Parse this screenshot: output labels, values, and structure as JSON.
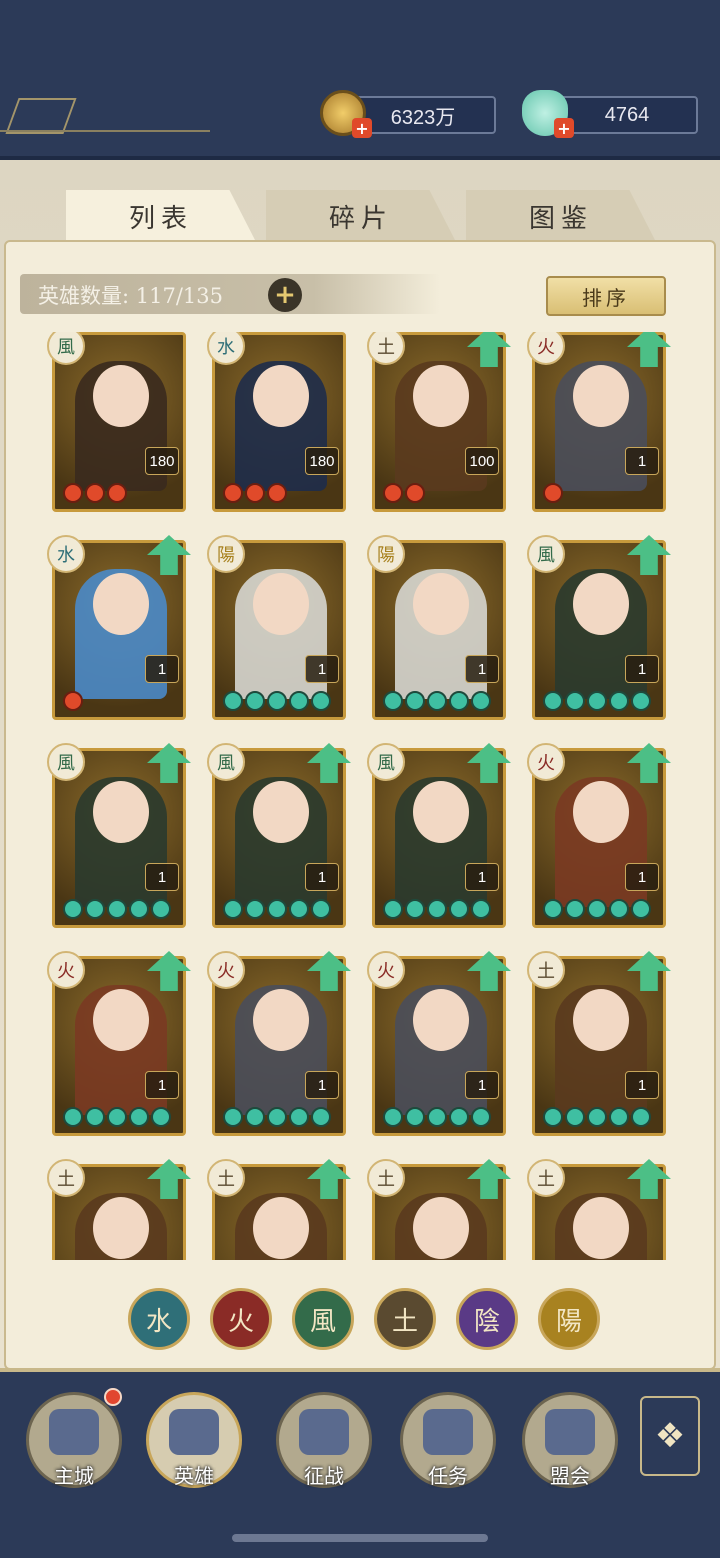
{
  "resources": {
    "coins": "6323万",
    "jade": "4764"
  },
  "tabs": [
    {
      "label": "列表",
      "active": true
    },
    {
      "label": "碎片",
      "active": false
    },
    {
      "label": "图鉴",
      "active": false
    }
  ],
  "hero_count_label": "英雄数量: 117/135",
  "sort_label": "排序",
  "colors": {
    "water": "#2f6f78",
    "fire": "#8a2b26",
    "wind": "#336b4a",
    "earth": "#5a4a30",
    "yin": "#5a3a86",
    "yang": "#a88220"
  },
  "heroes": [
    {
      "element": "風",
      "element_key": "wind",
      "level": "180",
      "stars": 3,
      "star_color": "red",
      "upgrade": false,
      "portrait": "#3a2a1e"
    },
    {
      "element": "水",
      "element_key": "water",
      "level": "180",
      "stars": 3,
      "star_color": "red",
      "upgrade": false,
      "portrait": "#1e2c4a"
    },
    {
      "element": "土",
      "element_key": "earth",
      "level": "100",
      "stars": 2,
      "star_color": "red",
      "upgrade": true,
      "portrait": "#5a3a1e"
    },
    {
      "element": "火",
      "element_key": "fire",
      "level": "1",
      "stars": 1,
      "star_color": "red",
      "upgrade": true,
      "portrait": "#4a4e5a"
    },
    {
      "element": "水",
      "element_key": "water",
      "level": "1",
      "stars": 1,
      "star_color": "red",
      "upgrade": true,
      "portrait": "#4a8ac8"
    },
    {
      "element": "陽",
      "element_key": "yang",
      "level": "1",
      "stars": 5,
      "star_color": "green",
      "upgrade": false,
      "portrait": "#d6d6d0"
    },
    {
      "element": "陽",
      "element_key": "yang",
      "level": "1",
      "stars": 5,
      "star_color": "green",
      "upgrade": false,
      "portrait": "#d6d6d0"
    },
    {
      "element": "風",
      "element_key": "wind",
      "level": "1",
      "stars": 5,
      "star_color": "green",
      "upgrade": true,
      "portrait": "#2a3a2e"
    },
    {
      "element": "風",
      "element_key": "wind",
      "level": "1",
      "stars": 5,
      "star_color": "green",
      "upgrade": true,
      "portrait": "#2a3a2e"
    },
    {
      "element": "風",
      "element_key": "wind",
      "level": "1",
      "stars": 5,
      "star_color": "green",
      "upgrade": true,
      "portrait": "#2a3a2e"
    },
    {
      "element": "風",
      "element_key": "wind",
      "level": "1",
      "stars": 5,
      "star_color": "green",
      "upgrade": true,
      "portrait": "#2a3a2e"
    },
    {
      "element": "火",
      "element_key": "fire",
      "level": "1",
      "stars": 5,
      "star_color": "green",
      "upgrade": true,
      "portrait": "#7a3a22"
    },
    {
      "element": "火",
      "element_key": "fire",
      "level": "1",
      "stars": 5,
      "star_color": "green",
      "upgrade": true,
      "portrait": "#7a3a22"
    },
    {
      "element": "火",
      "element_key": "fire",
      "level": "1",
      "stars": 5,
      "star_color": "green",
      "upgrade": true,
      "portrait": "#4a4e5a"
    },
    {
      "element": "火",
      "element_key": "fire",
      "level": "1",
      "stars": 5,
      "star_color": "green",
      "upgrade": true,
      "portrait": "#4a4e5a"
    },
    {
      "element": "土",
      "element_key": "earth",
      "level": "1",
      "stars": 5,
      "star_color": "green",
      "upgrade": true,
      "portrait": "#5a3a1e"
    },
    {
      "element": "土",
      "element_key": "earth",
      "level": "",
      "stars": 0,
      "star_color": "green",
      "upgrade": true,
      "portrait": "#5a3a1e"
    },
    {
      "element": "土",
      "element_key": "earth",
      "level": "",
      "stars": 0,
      "star_color": "green",
      "upgrade": true,
      "portrait": "#5a3a1e"
    },
    {
      "element": "土",
      "element_key": "earth",
      "level": "",
      "stars": 0,
      "star_color": "green",
      "upgrade": true,
      "portrait": "#5a3a1e"
    },
    {
      "element": "土",
      "element_key": "earth",
      "level": "",
      "stars": 0,
      "star_color": "green",
      "upgrade": true,
      "portrait": "#5a3a1e"
    }
  ],
  "filters": [
    {
      "label": "水",
      "key": "water"
    },
    {
      "label": "火",
      "key": "fire"
    },
    {
      "label": "風",
      "key": "wind"
    },
    {
      "label": "土",
      "key": "earth"
    },
    {
      "label": "陰",
      "key": "yin"
    },
    {
      "label": "陽",
      "key": "yang"
    }
  ],
  "nav": [
    {
      "label": "主城",
      "icon": "castle-icon"
    },
    {
      "label": "英雄",
      "icon": "hero-icon"
    },
    {
      "label": "征战",
      "icon": "battle-drum-icon"
    },
    {
      "label": "任务",
      "icon": "quest-bell-icon"
    },
    {
      "label": "盟会",
      "icon": "guild-pavilion-icon"
    }
  ]
}
